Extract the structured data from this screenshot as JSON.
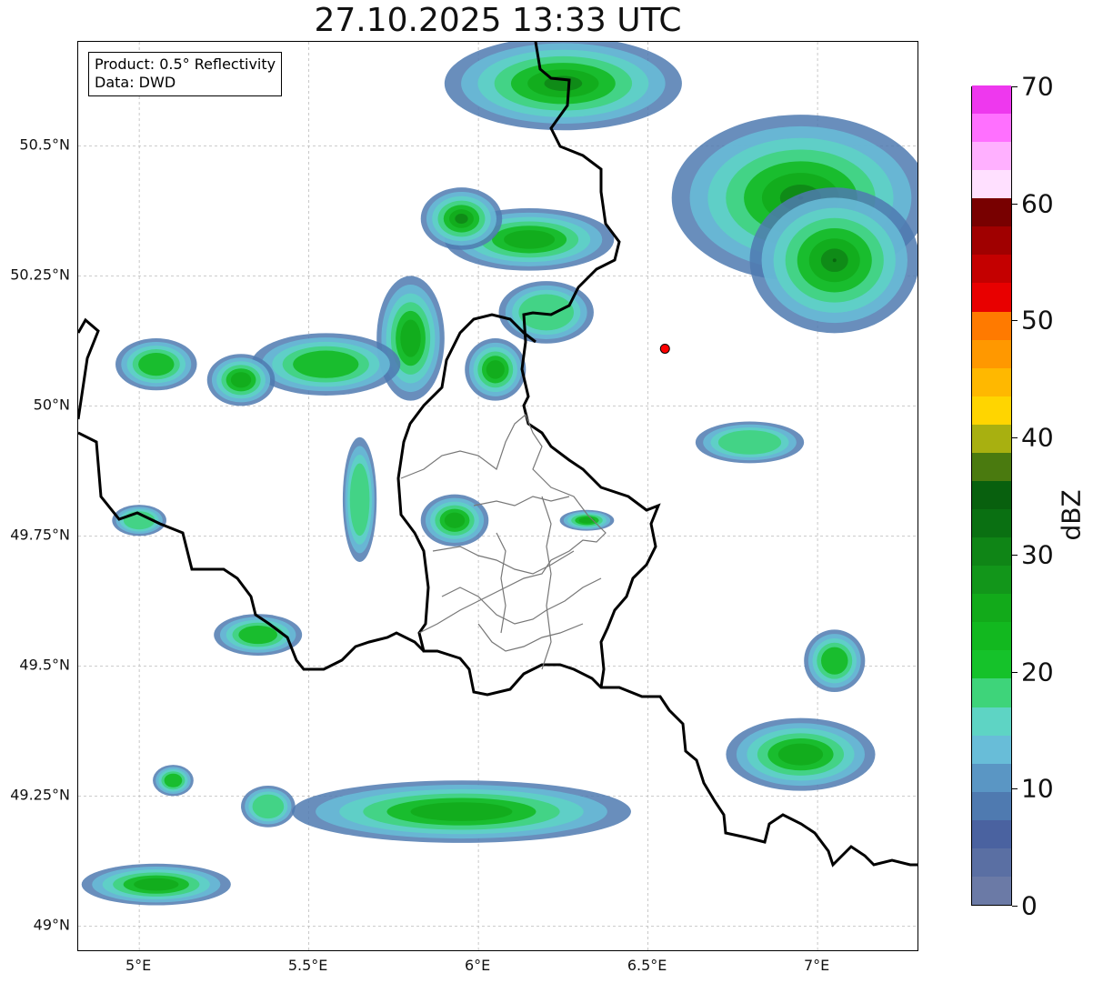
{
  "title": "27.10.2025 13:33 UTC",
  "info": {
    "product": "Product: 0.5° Reflectivity",
    "source": "Data: DWD"
  },
  "axes": {
    "lon_range": [
      4.82,
      7.3
    ],
    "lat_range": [
      48.95,
      50.7
    ],
    "x_ticks": [
      {
        "lon": 5.0,
        "label": "5°E"
      },
      {
        "lon": 5.5,
        "label": "5.5°E"
      },
      {
        "lon": 6.0,
        "label": "6°E"
      },
      {
        "lon": 6.5,
        "label": "6.5°E"
      },
      {
        "lon": 7.0,
        "label": "7°E"
      }
    ],
    "y_ticks": [
      {
        "lat": 50.5,
        "label": "50.5°N"
      },
      {
        "lat": 50.25,
        "label": "50.25°N"
      },
      {
        "lat": 50.0,
        "label": "50°N"
      },
      {
        "lat": 49.75,
        "label": "49.75°N"
      },
      {
        "lat": 49.5,
        "label": "49.5°N"
      },
      {
        "lat": 49.25,
        "label": "49.25°N"
      },
      {
        "lat": 49.0,
        "label": "49°N"
      }
    ],
    "grid": true
  },
  "radar_site": {
    "lon": 6.55,
    "lat": 50.11,
    "color": "#ff0000"
  },
  "colorbar": {
    "label": "dBZ",
    "range": [
      0,
      70
    ],
    "ticks": [
      {
        "value": 0,
        "label": "0"
      },
      {
        "value": 10,
        "label": "10"
      },
      {
        "value": 20,
        "label": "20"
      },
      {
        "value": 30,
        "label": "30"
      },
      {
        "value": 40,
        "label": "40"
      },
      {
        "value": 50,
        "label": "50"
      },
      {
        "value": 60,
        "label": "60"
      },
      {
        "value": 70,
        "label": "70"
      }
    ],
    "colors": [
      "#6b7aa6",
      "#5a6fa3",
      "#4a62a0",
      "#4f7ab0",
      "#5a96c4",
      "#68bdd8",
      "#5ed4c4",
      "#3ed47a",
      "#15c22a",
      "#12b81f",
      "#12aa1a",
      "#12961a",
      "#0f8516",
      "#0a7012",
      "#08600e",
      "#4a7a0f",
      "#a8b010",
      "#ffd500",
      "#ffb800",
      "#ff9800",
      "#ff7a00",
      "#e80000",
      "#c40000",
      "#a00000",
      "#780000",
      "#ffe0ff",
      "#ffb0ff",
      "#ff70ff",
      "#ee38ee"
    ]
  },
  "precip_cells": [
    {
      "lon": 6.25,
      "lat": 50.62,
      "rlon": 0.35,
      "rlat": 0.09,
      "level": 10
    },
    {
      "lon": 6.95,
      "lat": 50.4,
      "rlon": 0.38,
      "rlat": 0.16,
      "level": 13
    },
    {
      "lon": 7.05,
      "lat": 50.28,
      "rlon": 0.25,
      "rlat": 0.14,
      "level": 12
    },
    {
      "lon": 6.15,
      "lat": 50.32,
      "rlon": 0.25,
      "rlat": 0.06,
      "level": 9
    },
    {
      "lon": 5.95,
      "lat": 50.36,
      "rlon": 0.12,
      "rlat": 0.06,
      "level": 10
    },
    {
      "lon": 5.8,
      "lat": 50.13,
      "rlon": 0.1,
      "rlat": 0.12,
      "level": 9
    },
    {
      "lon": 5.55,
      "lat": 50.08,
      "rlon": 0.22,
      "rlat": 0.06,
      "level": 7
    },
    {
      "lon": 5.3,
      "lat": 50.05,
      "rlon": 0.1,
      "rlat": 0.05,
      "level": 8
    },
    {
      "lon": 5.05,
      "lat": 50.08,
      "rlon": 0.12,
      "rlat": 0.05,
      "level": 7
    },
    {
      "lon": 6.05,
      "lat": 50.07,
      "rlon": 0.09,
      "rlat": 0.06,
      "level": 8
    },
    {
      "lon": 6.2,
      "lat": 50.18,
      "rlon": 0.14,
      "rlat": 0.06,
      "level": 6
    },
    {
      "lon": 6.8,
      "lat": 49.93,
      "rlon": 0.16,
      "rlat": 0.04,
      "level": 5
    },
    {
      "lon": 5.93,
      "lat": 49.78,
      "rlon": 0.1,
      "rlat": 0.05,
      "level": 8
    },
    {
      "lon": 5.65,
      "lat": 49.82,
      "rlon": 0.05,
      "rlat": 0.12,
      "level": 6
    },
    {
      "lon": 6.32,
      "lat": 49.78,
      "rlon": 0.08,
      "rlat": 0.02,
      "level": 8
    },
    {
      "lon": 5.35,
      "lat": 49.56,
      "rlon": 0.13,
      "rlat": 0.04,
      "level": 7
    },
    {
      "lon": 5.0,
      "lat": 49.78,
      "rlon": 0.08,
      "rlat": 0.03,
      "level": 5
    },
    {
      "lon": 5.95,
      "lat": 49.22,
      "rlon": 0.5,
      "rlat": 0.06,
      "level": 9
    },
    {
      "lon": 6.95,
      "lat": 49.33,
      "rlon": 0.22,
      "rlat": 0.07,
      "level": 9
    },
    {
      "lon": 7.05,
      "lat": 49.51,
      "rlon": 0.09,
      "rlat": 0.06,
      "level": 7
    },
    {
      "lon": 5.05,
      "lat": 49.08,
      "rlon": 0.22,
      "rlat": 0.04,
      "level": 8
    },
    {
      "lon": 5.38,
      "lat": 49.23,
      "rlon": 0.08,
      "rlat": 0.04,
      "level": 6
    },
    {
      "lon": 5.1,
      "lat": 49.28,
      "rlon": 0.06,
      "rlat": 0.03,
      "level": 7
    }
  ]
}
